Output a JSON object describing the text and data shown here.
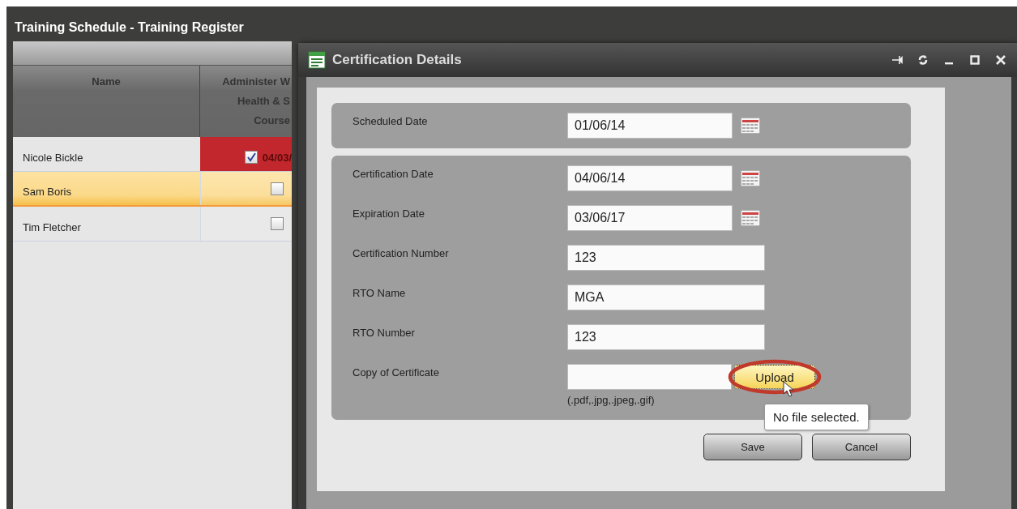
{
  "main_window": {
    "title": "Training Schedule - Training Register"
  },
  "grid": {
    "columns": [
      {
        "lines": [
          "Name"
        ]
      },
      {
        "lines": [
          "Administer W",
          "Health & S",
          "Course"
        ]
      }
    ],
    "rows": [
      {
        "name": "Nicole Bickle",
        "selected": false,
        "expired": true,
        "checked": true,
        "date": "04/03/"
      },
      {
        "name": "Sam Boris",
        "selected": true,
        "expired": false,
        "checked": false
      },
      {
        "name": "Tim Fletcher",
        "selected": false,
        "expired": false,
        "checked": false
      }
    ]
  },
  "dialog": {
    "title": "Certification Details",
    "sections": [
      {
        "fields": [
          {
            "label": "Scheduled Date",
            "value": "01/06/14",
            "kind": "date"
          }
        ]
      },
      {
        "fields": [
          {
            "label": "Certification Date",
            "value": "04/06/14",
            "kind": "date"
          },
          {
            "label": "Expiration Date",
            "value": "03/06/17",
            "kind": "date"
          },
          {
            "label": "Certification Number",
            "value": "123",
            "kind": "text"
          },
          {
            "label": "RTO Name",
            "value": "MGA",
            "kind": "text"
          },
          {
            "label": "RTO Number",
            "value": "123",
            "kind": "text"
          },
          {
            "label": "Copy of Certificate",
            "kind": "file",
            "button": "Upload",
            "annotated": true,
            "hint": "(.pdf,.jpg,.jpeg,.gif)",
            "tooltip": "No file selected."
          }
        ]
      }
    ],
    "buttons": [
      "Save",
      "Cancel"
    ]
  }
}
